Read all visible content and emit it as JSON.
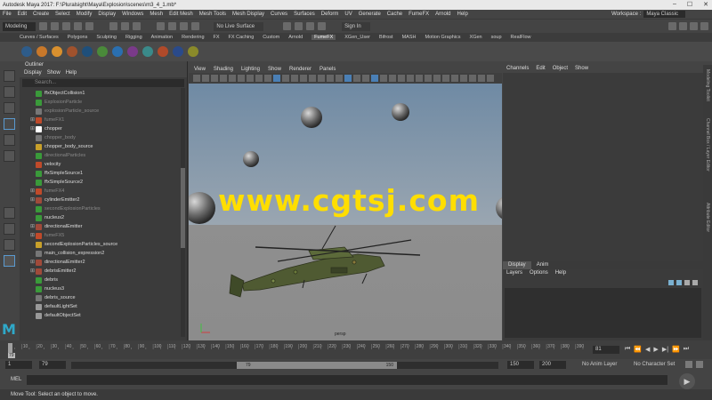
{
  "title_bar": {
    "title": "Autodesk Maya 2017: F:\\Pluralsight\\Maya\\Explosion\\scenes\\m3_4_1.mb*"
  },
  "menu_bar": {
    "items": [
      "File",
      "Edit",
      "Create",
      "Select",
      "Modify",
      "Display",
      "Windows",
      "Mesh",
      "Edit Mesh",
      "Mesh Tools",
      "Mesh Display",
      "Curves",
      "Surfaces",
      "Deform",
      "UV",
      "Generate",
      "Cache",
      "FumeFX",
      "Arnold",
      "Help"
    ],
    "workspace_label": "Workspace :",
    "workspace_value": "Maya Classic"
  },
  "status_line": {
    "mode": "Modeling",
    "live_surface": "No Live Surface",
    "sign_in": "Sign In"
  },
  "shelf_tabs": {
    "items": [
      "Curves / Surfaces",
      "Polygons",
      "Sculpting",
      "Rigging",
      "Animation",
      "Rendering",
      "FX",
      "FX Caching",
      "Custom",
      "Arnold",
      "FumeFX",
      "XGen_User",
      "Bifrost",
      "MASH",
      "Motion Graphics",
      "XGen",
      "soup",
      "RealFlow"
    ],
    "active": "FumeFX"
  },
  "shelf_icon_colors": [
    "#2e5c8a",
    "#c8782a",
    "#d9902e",
    "#a0522d",
    "#1f4f7a",
    "#4a8a3a",
    "#2a6fb0",
    "#7a3a8a",
    "#3a8a8a",
    "#b04a2a",
    "#2a4a8a",
    "#8a8a2a"
  ],
  "outliner": {
    "title": "Outliner",
    "menu": [
      "Display",
      "Show",
      "Help"
    ],
    "search_placeholder": "Search...",
    "rows": [
      {
        "label": "ffxObjectCollision1",
        "dim": false,
        "icon": "#3a9a3a",
        "plus": false
      },
      {
        "label": "ExplosionParticle",
        "dim": true,
        "icon": "#3a9a3a",
        "plus": false
      },
      {
        "label": "explosionParticle_source",
        "dim": true,
        "icon": "#777",
        "plus": false
      },
      {
        "label": "fumeFX1",
        "dim": true,
        "icon": "#c04a2a",
        "plus": true
      },
      {
        "label": "chopper",
        "dim": false,
        "icon": "#ffffff",
        "plus": true
      },
      {
        "label": "chopper_body",
        "dim": true,
        "icon": "#777",
        "plus": false
      },
      {
        "label": "chopper_body_source",
        "dim": false,
        "icon": "#c8a02a",
        "plus": false
      },
      {
        "label": "directionalParticles",
        "dim": true,
        "icon": "#3a9a3a",
        "plus": false
      },
      {
        "label": "velocity",
        "dim": false,
        "icon": "#c04a2a",
        "plus": false
      },
      {
        "label": "ffxSimpleSource1",
        "dim": false,
        "icon": "#3a9a3a",
        "plus": false
      },
      {
        "label": "ffxSimpleSource2",
        "dim": false,
        "icon": "#3a9a3a",
        "plus": false
      },
      {
        "label": "fumeFX4",
        "dim": true,
        "icon": "#c04a2a",
        "plus": true
      },
      {
        "label": "cylinderEmitter2",
        "dim": false,
        "icon": "#a04a3a",
        "plus": true
      },
      {
        "label": "secondExplosionParticles",
        "dim": true,
        "icon": "#3a9a3a",
        "plus": false
      },
      {
        "label": "nucleus2",
        "dim": false,
        "icon": "#3a9a3a",
        "plus": false
      },
      {
        "label": "directionalEmitter",
        "dim": false,
        "icon": "#a04a3a",
        "plus": true
      },
      {
        "label": "fumeFX5",
        "dim": true,
        "icon": "#c04a2a",
        "plus": true
      },
      {
        "label": "secondExplosionParticles_source",
        "dim": false,
        "icon": "#c8a02a",
        "plus": false
      },
      {
        "label": "main_collision_expression2",
        "dim": false,
        "icon": "#777",
        "plus": false
      },
      {
        "label": "directionalEmitter2",
        "dim": false,
        "icon": "#a04a3a",
        "plus": true
      },
      {
        "label": "debrisEmitter2",
        "dim": false,
        "icon": "#a04a3a",
        "plus": true
      },
      {
        "label": "debris",
        "dim": false,
        "icon": "#3a9a3a",
        "plus": false
      },
      {
        "label": "nucleus3",
        "dim": false,
        "icon": "#3a9a3a",
        "plus": false
      },
      {
        "label": "debris_source",
        "dim": false,
        "icon": "#777",
        "plus": false
      },
      {
        "label": "defaultLightSet",
        "dim": false,
        "icon": "#999",
        "plus": false
      },
      {
        "label": "defaultObjectSet",
        "dim": false,
        "icon": "#999",
        "plus": false
      }
    ]
  },
  "viewport": {
    "menu": [
      "View",
      "Shading",
      "Lighting",
      "Show",
      "Renderer",
      "Panels"
    ],
    "camera_label": "persp",
    "watermark": "www.cgtsj.com"
  },
  "channel_box": {
    "menu": [
      "Channels",
      "Edit",
      "Object",
      "Show"
    ]
  },
  "side_strip": {
    "labels": [
      "Modeling Toolkit",
      "Channel Box / Layer Editor",
      "Attribute Editor"
    ]
  },
  "layer_panel": {
    "tabs": [
      "Display",
      "Anim"
    ],
    "menu": [
      "Layers",
      "Options",
      "Help"
    ]
  },
  "timeline": {
    "ticks": [
      10,
      20,
      30,
      40,
      50,
      60,
      70,
      80,
      90,
      100,
      110,
      120,
      130,
      140,
      150,
      160,
      170,
      180,
      190,
      200,
      210,
      220,
      230,
      240,
      250,
      260,
      270,
      280,
      290,
      300,
      310,
      320,
      330,
      340,
      350,
      360,
      370,
      380,
      390
    ],
    "current_frame": "79",
    "current_frame_right": "81"
  },
  "range_bar": {
    "start": "1",
    "start_inner": "79",
    "slider_start": "79",
    "slider_end": "150",
    "end_inner": "150",
    "end": "200",
    "anim_layer": "No Anim Layer",
    "character_set": "No Character Set"
  },
  "command_line": {
    "label": "MEL"
  },
  "help_line": {
    "text": "Move Tool: Select an object to move."
  }
}
